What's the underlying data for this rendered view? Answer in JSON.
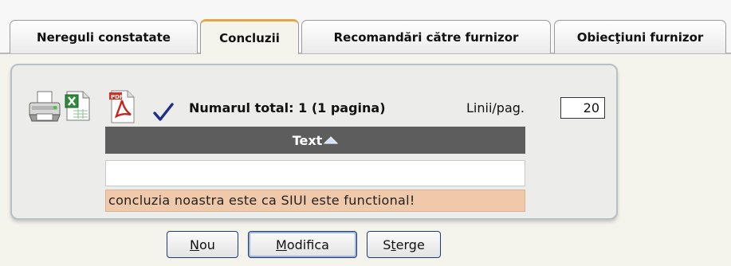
{
  "tabs": [
    {
      "label": "Nereguli constatate",
      "active": false
    },
    {
      "label": "Concluzii",
      "active": true
    },
    {
      "label": "Recomandări către furnizor",
      "active": false
    },
    {
      "label": "Obiecţiuni furnizor",
      "active": false
    }
  ],
  "toolbar": {
    "icons": [
      "printer-icon",
      "excel-icon",
      "pdf-icon",
      "checkmark-icon"
    ]
  },
  "pager": {
    "total_text": "Numarul total: 1 (1 pagina)",
    "lines_label": "Linii/pag.",
    "lines_value": "20"
  },
  "grid": {
    "columns": [
      {
        "label": "Text",
        "sort": "ascending"
      }
    ],
    "filter_value": "",
    "rows": [
      {
        "text": "concluzia noastra este ca SIUI este functional!"
      }
    ]
  },
  "buttons": {
    "new": {
      "accel": "N",
      "rest": "ou"
    },
    "edit": {
      "accel": "M",
      "rest": "odifica"
    },
    "delete": {
      "pre": "S",
      "accel": "t",
      "rest": "erge"
    }
  },
  "colors": {
    "header_bg": "#5d5d5d",
    "row_bg": "#efc9a9",
    "active_tab_top": "#e0a84a",
    "check": "#1a2f8a"
  }
}
